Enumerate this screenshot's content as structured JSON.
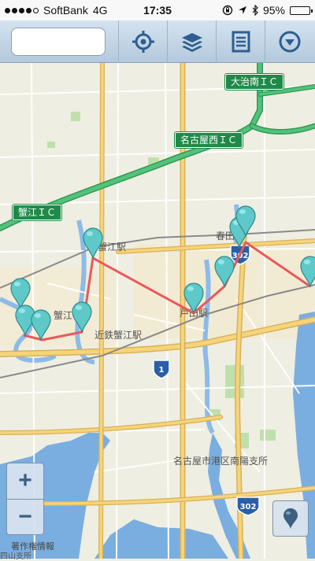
{
  "status_bar": {
    "carrier": "SoftBank",
    "network": "4G",
    "time": "17:35",
    "battery": "95%",
    "battery_level": 0.95,
    "signal_bars": 4
  },
  "toolbar": {
    "search_value": "",
    "buttons": [
      "locate-icon",
      "layers-icon",
      "list-icon",
      "dropdown-icon"
    ]
  },
  "map": {
    "ic_signs": [
      "大治南ＩＣ",
      "名古屋西ＩＣ",
      "蟹江ＩＣ"
    ],
    "labels": {
      "kanie_station": "蟹江駅",
      "kintetsu_kanie": "近鉄蟹江駅",
      "haruta": "春田",
      "toda_station": "戸田駅",
      "kanie_town": "蟹江",
      "nanyou_branch": "名古屋市港区南陽支所",
      "route_302": "302",
      "route_1": "1",
      "bottom_partial": "四山支所"
    },
    "colors": {
      "route_line": "#e8595c",
      "pin": "#5fc9c9",
      "expressway": "#3cb371",
      "water": "#7aaee0"
    }
  },
  "zoom": {
    "in_label": "+",
    "out_label": "−"
  },
  "attribution": "著作権情報"
}
